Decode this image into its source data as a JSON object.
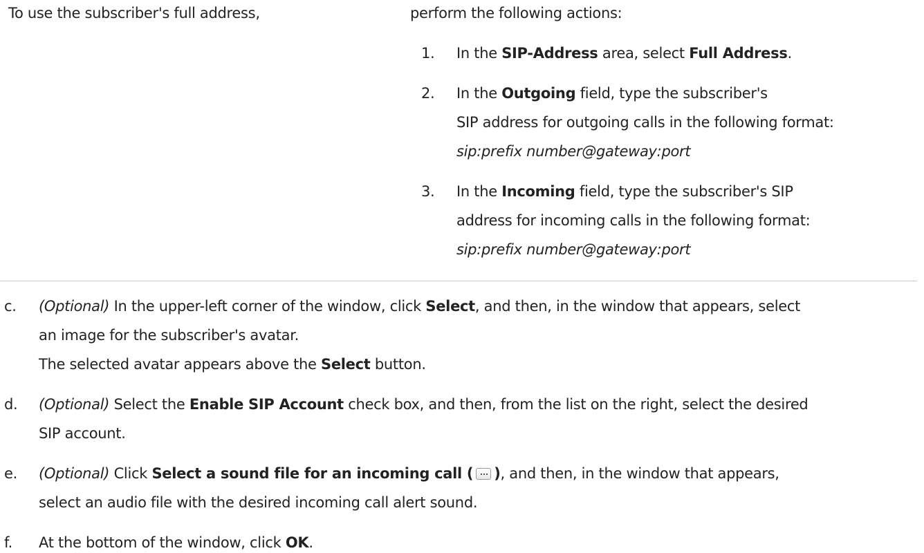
{
  "table_row": {
    "condition": "To use the subscriber's full address,",
    "action_intro": "perform the following actions:",
    "steps": [
      {
        "number": "1.",
        "t1": "In the ",
        "b1": "SIP-Address",
        "t2": " area, select ",
        "b2": "Full Address",
        "t3": "."
      },
      {
        "number": "2.",
        "t1": "In the ",
        "b1": "Outgoing",
        "t2": " field, type the subscriber's",
        "line2": "SIP address for outgoing calls in the following format:",
        "format": "sip:prefix number@gateway:port"
      },
      {
        "number": "3.",
        "t1": "In the ",
        "b1": "Incoming",
        "t2": " field, type the subscriber's SIP",
        "line2": "address for incoming calls in the following format:",
        "format": "sip:prefix number@gateway:port"
      }
    ]
  },
  "items": [
    {
      "letter": "c.",
      "optional": "(Optional)",
      "l1_t1": " In the upper-left corner of the window, click ",
      "l1_b1": "Select",
      "l1_t2": ", and then, in the window that appears, select",
      "l2": "an image for the subscriber's avatar.",
      "l3_t1": "The selected avatar appears above the ",
      "l3_b1": "Select",
      "l3_t2": " button."
    },
    {
      "letter": "d.",
      "optional": "(Optional)",
      "l1_t1": " Select the ",
      "l1_b1": "Enable SIP Account",
      "l1_t2": " check box, and then, from the list on the right, select the desired",
      "l2": "SIP account."
    },
    {
      "letter": "e.",
      "optional": "(Optional)",
      "l1_t1": " Click ",
      "l1_b1": "Select a sound file for an incoming call (",
      "l1_b2": ")",
      "l1_t2": ", and then, in the window that appears,",
      "l2": "select an audio file with the desired incoming call alert sound."
    },
    {
      "letter": "f.",
      "l1_t1": "At the bottom of the window, click ",
      "l1_b1": "OK",
      "l1_t2": "."
    }
  ]
}
